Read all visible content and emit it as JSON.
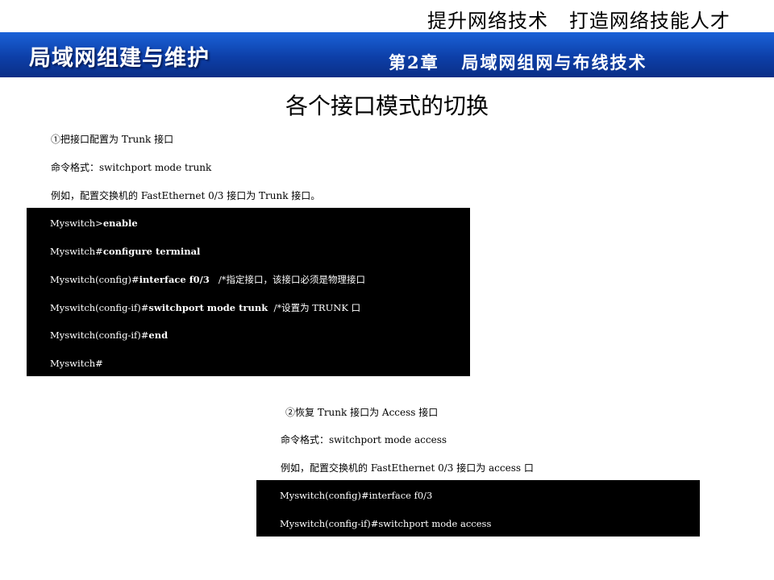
{
  "header": {
    "slogan": "提升网络技术   打造网络技能人才",
    "banner_title": "局域网组建与维护",
    "chapter": "第2章   局域网组网与布线技术"
  },
  "page_title": "各个接口模式的切换",
  "section1": {
    "heading": "①把接口配置为 Trunk 接口",
    "format": "命令格式：switchport mode trunk",
    "example": "例如，配置交换机的 FastEthernet 0/3 接口为 Trunk 接口。",
    "terminal": [
      {
        "prompt": "Myswitch>",
        "cmd": "enable",
        "note": ""
      },
      {
        "prompt": "Myswitch#",
        "cmd": "configure terminal",
        "note": ""
      },
      {
        "prompt": "Myswitch(config)#",
        "cmd": "interface f0/3",
        "note": "   /*指定接口，该接口必须是物理接口"
      },
      {
        "prompt": "Myswitch(config-if)#",
        "cmd": "switchport mode trunk",
        "note": "  /*设置为 TRUNK 口"
      },
      {
        "prompt": "Myswitch(config-if)#",
        "cmd": "end",
        "note": ""
      },
      {
        "prompt": "Myswitch#",
        "cmd": "",
        "note": ""
      }
    ]
  },
  "section2": {
    "heading": "②恢复 Trunk 接口为 Access 接口",
    "format": "命令格式：switchport mode access",
    "example": "例如，配置交换机的 FastEthernet 0/3 接口为 access 口",
    "terminal": [
      "Myswitch(config)#interface f0/3",
      "Myswitch(config-if)#switchport mode access"
    ]
  }
}
